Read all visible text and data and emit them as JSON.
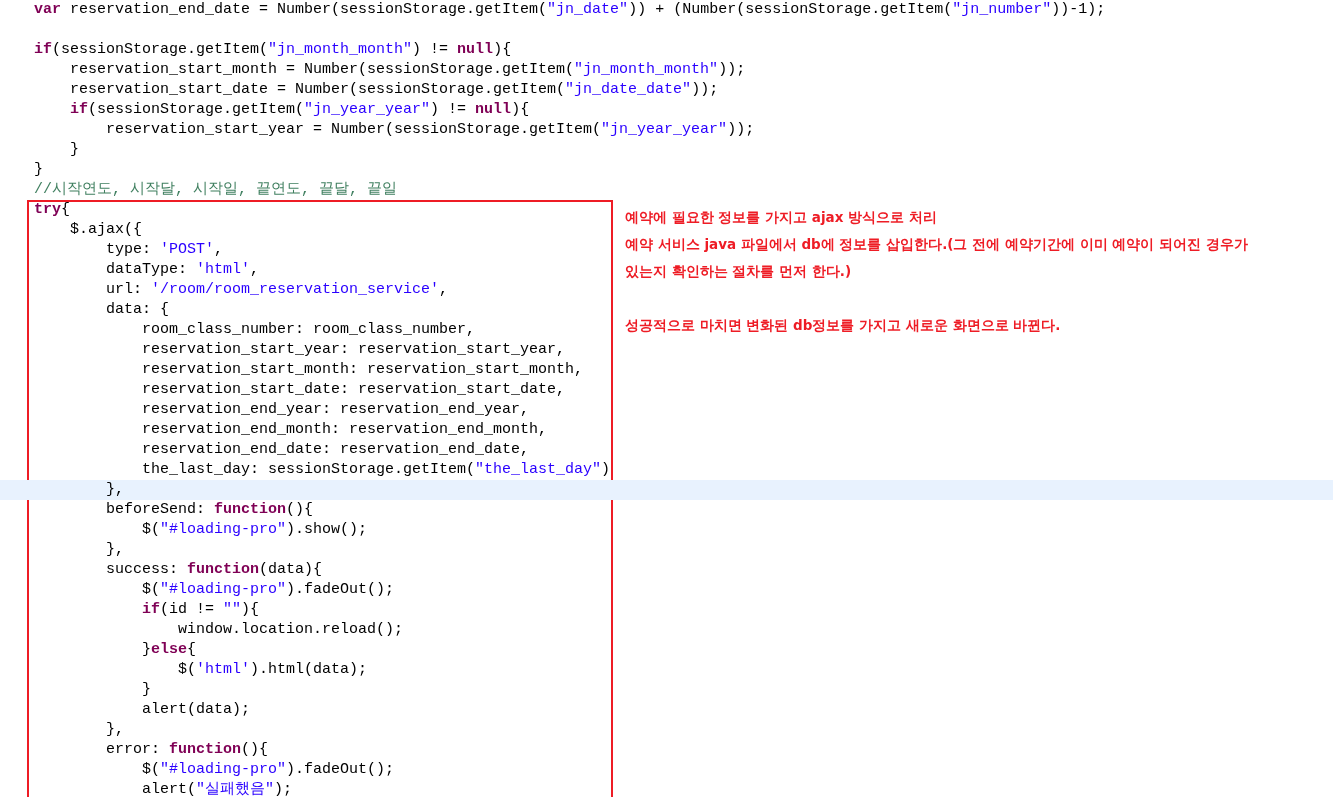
{
  "code": {
    "lines": [
      {
        "kind": "code",
        "current": false,
        "tokens": [
          {
            "kind": "keyword",
            "text": "var"
          },
          {
            "kind": "plain",
            "text": " reservation_end_date = Number(sessionStorage.getItem("
          },
          {
            "kind": "string",
            "text": "\"jn_date\""
          },
          {
            "kind": "plain",
            "text": ")) + (Number(sessionStorage.getItem("
          },
          {
            "kind": "string",
            "text": "\"jn_number\""
          },
          {
            "kind": "plain",
            "text": "))-1);"
          }
        ]
      },
      {
        "kind": "blank",
        "current": false
      },
      {
        "kind": "code",
        "current": false,
        "tokens": [
          {
            "kind": "keyword",
            "text": "if"
          },
          {
            "kind": "plain",
            "text": "(sessionStorage.getItem("
          },
          {
            "kind": "string",
            "text": "\"jn_month_month\""
          },
          {
            "kind": "plain",
            "text": ") != "
          },
          {
            "kind": "keyword",
            "text": "null"
          },
          {
            "kind": "plain",
            "text": "){"
          }
        ]
      },
      {
        "kind": "code",
        "current": false,
        "tokens": [
          {
            "kind": "plain",
            "text": "    reservation_start_month = Number(sessionStorage.getItem("
          },
          {
            "kind": "string",
            "text": "\"jn_month_month\""
          },
          {
            "kind": "plain",
            "text": "));"
          }
        ]
      },
      {
        "kind": "code",
        "current": false,
        "tokens": [
          {
            "kind": "plain",
            "text": "    reservation_start_date = Number(sessionStorage.getItem("
          },
          {
            "kind": "string",
            "text": "\"jn_date_date\""
          },
          {
            "kind": "plain",
            "text": "));"
          }
        ]
      },
      {
        "kind": "code",
        "current": false,
        "tokens": [
          {
            "kind": "keyword",
            "text": "    if"
          },
          {
            "kind": "plain",
            "text": "(sessionStorage.getItem("
          },
          {
            "kind": "string",
            "text": "\"jn_year_year\""
          },
          {
            "kind": "plain",
            "text": ") != "
          },
          {
            "kind": "keyword",
            "text": "null"
          },
          {
            "kind": "plain",
            "text": "){"
          }
        ]
      },
      {
        "kind": "code",
        "current": false,
        "tokens": [
          {
            "kind": "plain",
            "text": "        reservation_start_year = Number(sessionStorage.getItem("
          },
          {
            "kind": "string",
            "text": "\"jn_year_year\""
          },
          {
            "kind": "plain",
            "text": "));"
          }
        ]
      },
      {
        "kind": "code",
        "current": false,
        "tokens": [
          {
            "kind": "plain",
            "text": "    }"
          }
        ]
      },
      {
        "kind": "code",
        "current": false,
        "tokens": [
          {
            "kind": "plain",
            "text": "}"
          }
        ]
      },
      {
        "kind": "code",
        "current": false,
        "tokens": [
          {
            "kind": "comment",
            "text": "//시작연도, 시작달, 시작일, 끝연도, 끝달, 끝일"
          }
        ]
      }
    ]
  },
  "marked_block": {
    "lines": [
      {
        "kind": "code",
        "current": false,
        "tokens": [
          {
            "kind": "keyword",
            "text": "try"
          },
          {
            "kind": "plain",
            "text": "{"
          }
        ]
      },
      {
        "kind": "code",
        "current": false,
        "tokens": [
          {
            "kind": "plain",
            "text": "    $.ajax({"
          }
        ]
      },
      {
        "kind": "code",
        "current": false,
        "tokens": [
          {
            "kind": "plain",
            "text": "        type: "
          },
          {
            "kind": "string",
            "text": "'POST'"
          },
          {
            "kind": "plain",
            "text": ","
          }
        ]
      },
      {
        "kind": "code",
        "current": false,
        "tokens": [
          {
            "kind": "plain",
            "text": "        dataType: "
          },
          {
            "kind": "string",
            "text": "'html'"
          },
          {
            "kind": "plain",
            "text": ","
          }
        ]
      },
      {
        "kind": "code",
        "current": false,
        "tokens": [
          {
            "kind": "plain",
            "text": "        url: "
          },
          {
            "kind": "string",
            "text": "'/room/room_reservation_service'"
          },
          {
            "kind": "plain",
            "text": ","
          }
        ]
      },
      {
        "kind": "code",
        "current": false,
        "tokens": [
          {
            "kind": "plain",
            "text": "        data: {"
          }
        ]
      },
      {
        "kind": "code",
        "current": false,
        "tokens": [
          {
            "kind": "plain",
            "text": "            room_class_number: room_class_number,"
          }
        ]
      },
      {
        "kind": "code",
        "current": false,
        "tokens": [
          {
            "kind": "plain",
            "text": "            reservation_start_year: reservation_start_year,"
          }
        ]
      },
      {
        "kind": "code",
        "current": false,
        "tokens": [
          {
            "kind": "plain",
            "text": "            reservation_start_month: reservation_start_month,"
          }
        ]
      },
      {
        "kind": "code",
        "current": false,
        "tokens": [
          {
            "kind": "plain",
            "text": "            reservation_start_date: reservation_start_date,"
          }
        ]
      },
      {
        "kind": "code",
        "current": false,
        "tokens": [
          {
            "kind": "plain",
            "text": "            reservation_end_year: reservation_end_year,"
          }
        ]
      },
      {
        "kind": "code",
        "current": false,
        "tokens": [
          {
            "kind": "plain",
            "text": "            reservation_end_month: reservation_end_month,"
          }
        ]
      },
      {
        "kind": "code",
        "current": false,
        "tokens": [
          {
            "kind": "plain",
            "text": "            reservation_end_date: reservation_end_date,"
          }
        ]
      },
      {
        "kind": "code",
        "current": false,
        "tokens": [
          {
            "kind": "plain",
            "text": "            the_last_day: sessionStorage.getItem("
          },
          {
            "kind": "string",
            "text": "\"the_last_day\""
          },
          {
            "kind": "plain",
            "text": ")"
          }
        ]
      },
      {
        "kind": "code",
        "current": true,
        "tokens": [
          {
            "kind": "plain",
            "text": "        },"
          }
        ]
      },
      {
        "kind": "code",
        "current": false,
        "tokens": [
          {
            "kind": "plain",
            "text": "        beforeSend: "
          },
          {
            "kind": "keyword",
            "text": "function"
          },
          {
            "kind": "plain",
            "text": "(){"
          }
        ]
      },
      {
        "kind": "code",
        "current": false,
        "tokens": [
          {
            "kind": "plain",
            "text": "            $("
          },
          {
            "kind": "string",
            "text": "\"#loading-pro\""
          },
          {
            "kind": "plain",
            "text": ").show();"
          }
        ]
      },
      {
        "kind": "code",
        "current": false,
        "tokens": [
          {
            "kind": "plain",
            "text": "        },"
          }
        ]
      },
      {
        "kind": "code",
        "current": false,
        "tokens": [
          {
            "kind": "plain",
            "text": "        success: "
          },
          {
            "kind": "keyword",
            "text": "function"
          },
          {
            "kind": "plain",
            "text": "(data){"
          }
        ]
      },
      {
        "kind": "code",
        "current": false,
        "tokens": [
          {
            "kind": "plain",
            "text": "            $("
          },
          {
            "kind": "string",
            "text": "\"#loading-pro\""
          },
          {
            "kind": "plain",
            "text": ").fadeOut();"
          }
        ]
      },
      {
        "kind": "code",
        "current": false,
        "tokens": [
          {
            "kind": "keyword",
            "text": "            if"
          },
          {
            "kind": "plain",
            "text": "(id != "
          },
          {
            "kind": "string",
            "text": "\"\""
          },
          {
            "kind": "plain",
            "text": "){"
          }
        ]
      },
      {
        "kind": "code",
        "current": false,
        "tokens": [
          {
            "kind": "plain",
            "text": "                window.location.reload();"
          }
        ]
      },
      {
        "kind": "code",
        "current": false,
        "tokens": [
          {
            "kind": "plain",
            "text": "            }"
          },
          {
            "kind": "keyword",
            "text": "else"
          },
          {
            "kind": "plain",
            "text": "{"
          }
        ]
      },
      {
        "kind": "code",
        "current": false,
        "tokens": [
          {
            "kind": "plain",
            "text": "                $("
          },
          {
            "kind": "string",
            "text": "'html'"
          },
          {
            "kind": "plain",
            "text": ").html(data);"
          }
        ]
      },
      {
        "kind": "code",
        "current": false,
        "tokens": [
          {
            "kind": "plain",
            "text": "            }"
          }
        ]
      },
      {
        "kind": "code",
        "current": false,
        "tokens": [
          {
            "kind": "plain",
            "text": "            alert(data);"
          }
        ]
      },
      {
        "kind": "code",
        "current": false,
        "tokens": [
          {
            "kind": "plain",
            "text": "        },"
          }
        ]
      },
      {
        "kind": "code",
        "current": false,
        "tokens": [
          {
            "kind": "plain",
            "text": "        error: "
          },
          {
            "kind": "keyword",
            "text": "function"
          },
          {
            "kind": "plain",
            "text": "(){"
          }
        ]
      },
      {
        "kind": "code",
        "current": false,
        "tokens": [
          {
            "kind": "plain",
            "text": "            $("
          },
          {
            "kind": "string",
            "text": "\"#loading-pro\""
          },
          {
            "kind": "plain",
            "text": ").fadeOut();"
          }
        ]
      },
      {
        "kind": "code",
        "current": false,
        "tokens": [
          {
            "kind": "plain",
            "text": "            alert("
          },
          {
            "kind": "string",
            "text": "\"실패했음\""
          },
          {
            "kind": "plain",
            "text": ");"
          }
        ]
      }
    ]
  },
  "annotation": {
    "paragraphs": [
      {
        "text": "예약에 필요한 정보를 가지고 ajax 방식으로 처리",
        "gap_before": false
      },
      {
        "text": "예약 서비스 java 파일에서 db에 정보를 삽입한다.(그 전에 예약기간에 이미 예약이 되어진 경우가 있는지 확인하는 절차를 먼저 한다.)",
        "gap_before": false
      },
      {
        "text": "성공적으로 마치면 변화된 db정보를 가지고 새로운 화면으로 바뀐다.",
        "gap_before": true
      }
    ]
  }
}
